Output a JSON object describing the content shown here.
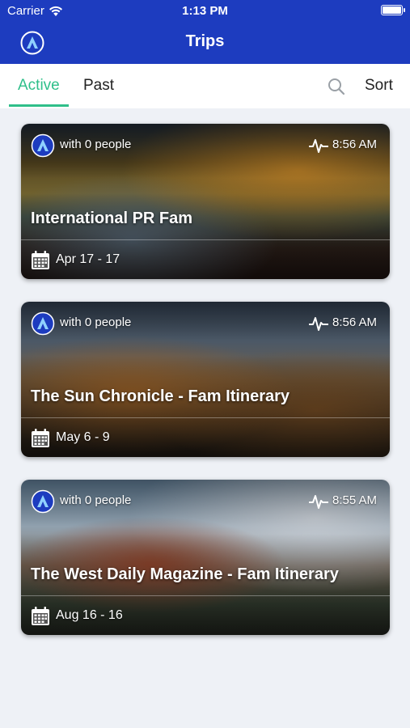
{
  "status_bar": {
    "carrier": "Carrier",
    "time": "1:13 PM"
  },
  "nav": {
    "title": "Trips",
    "logo_icon": "app-logo-icon"
  },
  "tabs": [
    {
      "label": "Active"
    },
    {
      "label": "Past"
    }
  ],
  "toolbar": {
    "sort_label": "Sort",
    "search_icon": "search-icon"
  },
  "colors": {
    "header": "#1d3cbf",
    "accent": "#2fbf8a",
    "background": "#eef1f6"
  },
  "trips": [
    {
      "people": "with 0 people",
      "time": "8:56 AM",
      "title": "International PR Fam",
      "dates": "Apr 17 - 17"
    },
    {
      "people": "with 0 people",
      "time": "8:56 AM",
      "title": "The Sun Chronicle - Fam Itinerary",
      "dates": "May 6 - 9"
    },
    {
      "people": "with 0 people",
      "time": "8:55 AM",
      "title": "The West Daily Magazine - Fam Itinerary",
      "dates": "Aug 16 - 16"
    }
  ]
}
